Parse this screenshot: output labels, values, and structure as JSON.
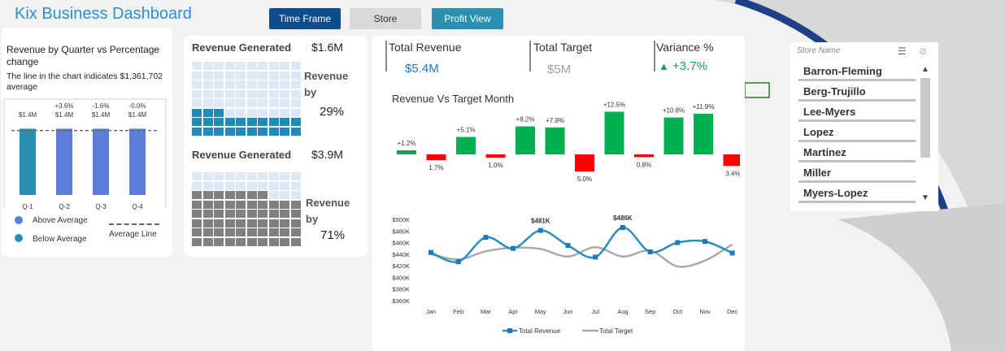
{
  "title": "Kix Business Dashboard",
  "buttons": {
    "time_frame": "Time Frame",
    "store": "Store",
    "profit_view": "Profit View"
  },
  "quarter_panel": {
    "title": "Revenue by Quarter vs Percentage change",
    "note": "The line in the chart indicates $1,361,702 average",
    "legend": {
      "above": "Above Average",
      "below": "Below Average",
      "line": "Average Line"
    },
    "colors": {
      "above": "#5b7fd8",
      "below": "#2a8fb0",
      "avg_line": "#666666"
    }
  },
  "revenue_generated": [
    {
      "label": "Revenue Generated",
      "value": "$1.6M",
      "rev_by": "Revenue by",
      "pct": "29%"
    },
    {
      "label": "Revenue Generated",
      "value": "$3.9M",
      "rev_by": "Revenue by",
      "pct": "71%"
    }
  ],
  "waffle": {
    "filled_1": 29,
    "filled_2": 71,
    "color_1": "#1f8bb8",
    "color_2": "#808080",
    "empty": "#ddeaf6"
  },
  "kpis": {
    "total_revenue": {
      "label": "Total Revenue",
      "value": "$5.4M",
      "color": "#1f77c2"
    },
    "total_target": {
      "label": "Total Target",
      "value": "$5M",
      "color": "#a0a0a0"
    },
    "variance": {
      "label": "Variance %",
      "value": "+3.7%",
      "arrow": "▲",
      "color": "#1aa34a"
    }
  },
  "variance_chart_title": "Revenue Vs Target Month",
  "slicer": {
    "header": "Store Name",
    "items": [
      "Barron-Fleming",
      "Berg-Trujillo",
      "Lee-Myers",
      "Lopez",
      "Martinez",
      "Miller",
      "Myers-Lopez"
    ]
  },
  "chart_data": [
    {
      "type": "bar",
      "categories": [
        "Q-1",
        "Q-2",
        "Q-3",
        "Q-4"
      ],
      "values": [
        1.4,
        1.4,
        1.4,
        1.4
      ],
      "value_labels": [
        "$1.4M",
        "$1.4M",
        "$1.4M",
        "$1.4M"
      ],
      "pct_change": [
        "",
        "+3.6%",
        "-1.6%",
        "-0.0%"
      ],
      "above_average": [
        false,
        true,
        true,
        true
      ],
      "average": 1.361702,
      "title": "Revenue by Quarter vs Percentage change"
    },
    {
      "type": "bar",
      "title": "Revenue Vs Target Month",
      "categories": [
        "Jan",
        "Feb",
        "Mar",
        "Apr",
        "May",
        "Jun",
        "Jul",
        "Aug",
        "Sep",
        "Oct",
        "Nov",
        "Dec"
      ],
      "values": [
        1.2,
        -1.7,
        5.1,
        -1.0,
        8.2,
        7.9,
        -5.0,
        12.5,
        -0.8,
        10.8,
        11.9,
        -3.4
      ],
      "labels": [
        "+1.2%",
        "1.7%",
        "+5.1%",
        "1.0%",
        "+8.2%",
        "+7.9%",
        "5.0%",
        "+12.5%",
        "0.8%",
        "+10.8%",
        "+11.9%",
        "3.4%"
      ],
      "colors": {
        "positive": "#00b050",
        "negative": "#ff0000"
      }
    },
    {
      "type": "line",
      "x": [
        "Jan",
        "Feb",
        "Mar",
        "Apr",
        "May",
        "Jun",
        "Jul",
        "Aug",
        "Sep",
        "Oct",
        "Nov",
        "Dec"
      ],
      "series": [
        {
          "name": "Total Revenue",
          "values": [
            443,
            427,
            469,
            450,
            481,
            455,
            435,
            486,
            444,
            460,
            462,
            442
          ],
          "color": "#2a8fb8"
        },
        {
          "name": "Total Target",
          "values": [
            440,
            431,
            445,
            451,
            449,
            436,
            452,
            436,
            446,
            419,
            429,
            457
          ],
          "color": "#aaaaaa"
        }
      ],
      "point_labels": [
        {
          "index": 4,
          "text": "$481K"
        },
        {
          "index": 7,
          "text": "$486K"
        }
      ],
      "yticks": [
        "$500K",
        "$480K",
        "$460K",
        "$440K",
        "$420K",
        "$400K",
        "$380K",
        "$360K"
      ],
      "ylim": [
        360,
        500
      ]
    }
  ]
}
